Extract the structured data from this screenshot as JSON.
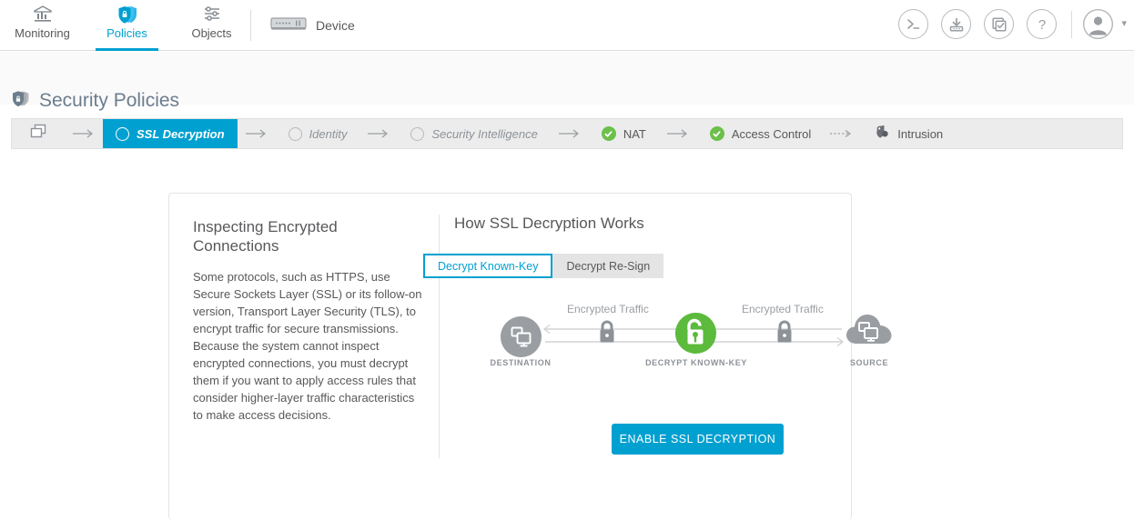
{
  "topnav": {
    "tabs": [
      {
        "label": "Monitoring",
        "icon": "monitoring-chart-icon",
        "active": false
      },
      {
        "label": "Policies",
        "icon": "policies-shield-icon",
        "active": true
      },
      {
        "label": "Objects",
        "icon": "objects-sliders-icon",
        "active": false
      }
    ],
    "device": {
      "label": "Device",
      "icon": "device-appliance-icon"
    },
    "actions": [
      {
        "name": "cli-console-icon",
        "glyph": ">_"
      },
      {
        "name": "deploy-download-icon",
        "glyph": "deploy"
      },
      {
        "name": "tasks-checklist-icon",
        "glyph": "tasks"
      },
      {
        "name": "help-question-icon",
        "glyph": "?"
      }
    ],
    "account": {
      "name": "user-avatar",
      "caret": "▾"
    }
  },
  "page": {
    "title": "Security Policies",
    "title_icon": "security-policies-shield-icon"
  },
  "chain": {
    "first_icon": "interfaces-layers-icon",
    "arrow": "→",
    "dotted_arrow": "⇢",
    "steps": [
      {
        "label": "SSL Decryption",
        "state": "active",
        "marker": "ring"
      },
      {
        "label": "Identity",
        "state": "pending",
        "marker": "ring"
      },
      {
        "label": "Security Intelligence",
        "state": "pending",
        "marker": "ring"
      },
      {
        "label": "NAT",
        "state": "done",
        "marker": "check"
      },
      {
        "label": "Access Control",
        "state": "done",
        "marker": "check"
      },
      {
        "label": "Intrusion",
        "state": "plain",
        "marker": "intrusion-icon"
      }
    ]
  },
  "card": {
    "left": {
      "title": "Inspecting Encrypted Connections",
      "body": "Some protocols, such as HTTPS, use Secure Sockets Layer (SSL) or its follow-on version, Transport Layer Security (TLS), to encrypt traffic for secure transmissions. Because the system cannot inspect encrypted connections, you must decrypt them if you want to apply access rules that consider higher-layer traffic characteristics to make access decisions."
    },
    "right": {
      "title": "How SSL Decryption Works",
      "toggle": [
        {
          "label": "Decrypt Known-Key",
          "selected": true
        },
        {
          "label": "Decrypt Re-Sign",
          "selected": false
        }
      ],
      "diagram": {
        "nodes": [
          {
            "label": "DESTINATION",
            "icon": "destination-monitors-circle-icon"
          },
          {
            "label": "DECRYPT KNOWN-KEY",
            "icon": "unlocked-padlock-key-icon"
          },
          {
            "label": "SOURCE",
            "icon": "source-cloud-monitors-icon"
          }
        ],
        "traffic_labels": [
          "Encrypted Traffic",
          "Encrypted Traffic"
        ],
        "lock_icon": "closed-padlock-icon"
      },
      "cta_label": "ENABLE SSL DECRYPTION"
    }
  },
  "colors": {
    "accent": "#00a0d1",
    "success": "#6cc04a",
    "text": "#58585b",
    "muted": "#9a9ea2",
    "chain_bg": "#ececec",
    "page_bg": "#fafafa"
  }
}
